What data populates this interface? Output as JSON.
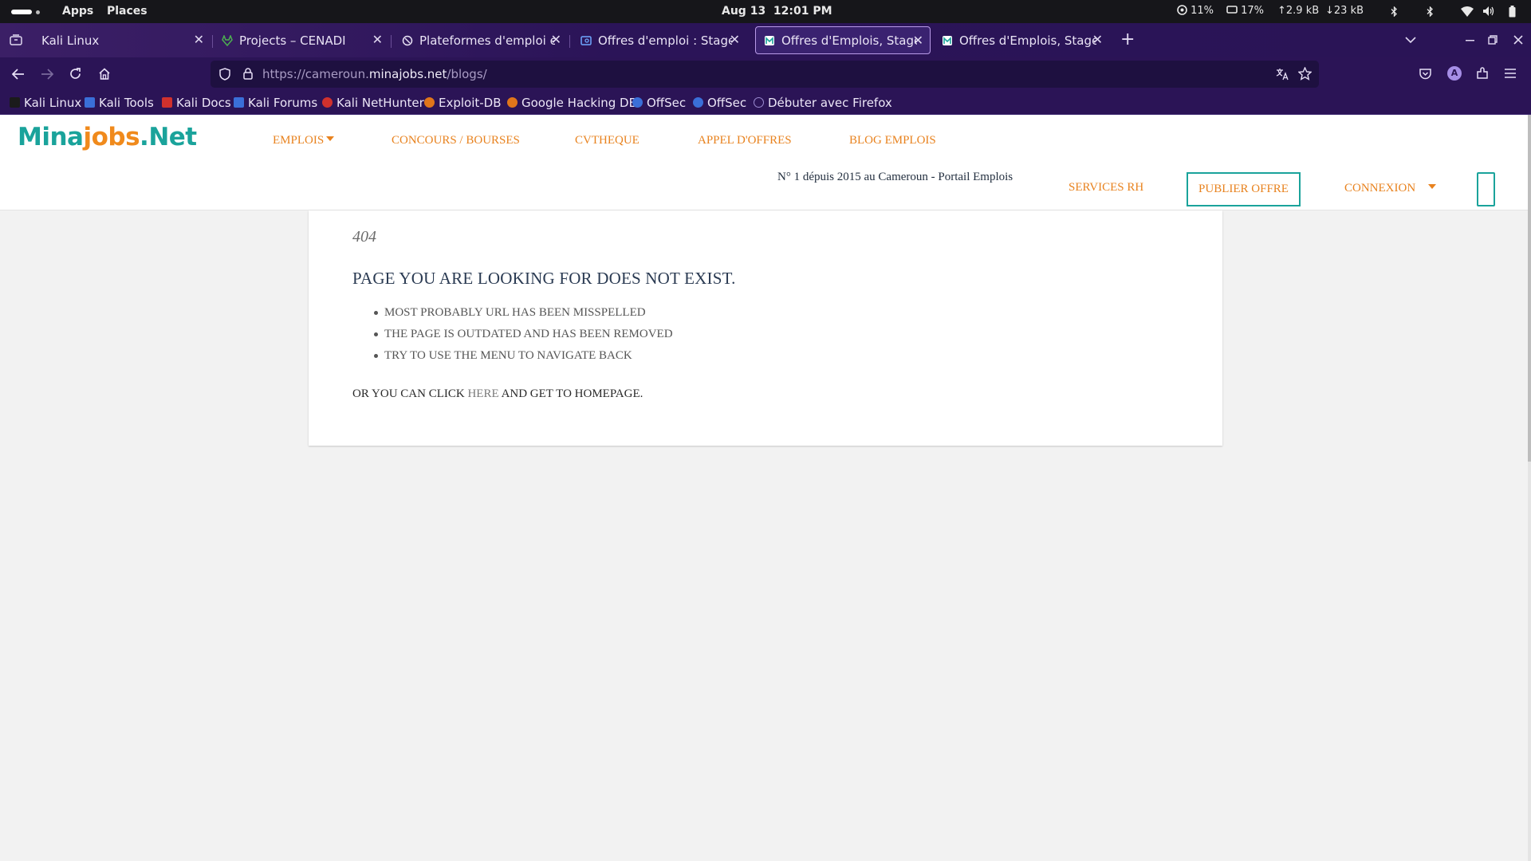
{
  "system_bar": {
    "apps": "Apps",
    "places": "Places",
    "clock": "Aug 13  12:01 PM",
    "cpu": "11%",
    "mem": "17%",
    "upload": "2.9 kB",
    "download": "23 kB"
  },
  "tabs": [
    {
      "label": "Kali Linux",
      "active": false
    },
    {
      "label": "Projects – CENADI",
      "active": false
    },
    {
      "label": "Plateformes d'emploi et s",
      "active": false
    },
    {
      "label": "Offres d'emploi : Stage au",
      "active": false
    },
    {
      "label": "Offres d'Emplois, Stages",
      "active": true
    },
    {
      "label": "Offres d'Emplois, Stages",
      "active": false
    }
  ],
  "urlbar": {
    "prefix": "https://cameroun.",
    "domain": "minajobs.net",
    "path": "/blogs/"
  },
  "bookmarks": [
    {
      "label": "Kali Linux",
      "color": "#2d2d2d"
    },
    {
      "label": "Kali Tools",
      "color": "#3a6fd8"
    },
    {
      "label": "Kali Docs",
      "color": "#d0312d"
    },
    {
      "label": "Kali Forums",
      "color": "#3a6fd8"
    },
    {
      "label": "Kali NetHunter",
      "color": "#d0312d"
    },
    {
      "label": "Exploit-DB",
      "color": "#e0761a"
    },
    {
      "label": "Google Hacking DB",
      "color": "#e0761a"
    },
    {
      "label": "OffSec",
      "color": "#3a6fd8"
    },
    {
      "label": "OffSec",
      "color": "#3a6fd8"
    },
    {
      "label": "Débuter avec Firefox",
      "color": "#9a8ad0"
    }
  ],
  "site": {
    "logo_part1": "Mina",
    "logo_part2": "jobs",
    "logo_part3": ".Net",
    "menu": {
      "emplois": "EMPLOIS",
      "concours": "CONCOURS / BOURSES",
      "cvtheque": "CVTHEQUE",
      "appel": "APPEL D'OFFRES",
      "blog": "BLOG EMPLOIS",
      "services": "SERVICES RH",
      "publier": "PUBLIER OFFRE",
      "connexion": "CONNEXION"
    },
    "tagline": "N° 1 dépuis 2015 au Cameroun - Portail Emplois"
  },
  "error_page": {
    "code": "404",
    "title": "PAGE YOU ARE LOOKING FOR DOES NOT EXIST.",
    "reasons": [
      "MOST PROBABLY URL HAS BEEN MISSPELLED",
      "THE PAGE IS OUTDATED AND HAS BEEN REMOVED",
      "TRY TO USE THE MENU TO NAVIGATE BACK"
    ],
    "footer_before": "OR YOU CAN CLICK",
    "footer_link": "HERE",
    "footer_after": "AND GET TO HOMEPAGE."
  },
  "colors": {
    "brand_teal": "#1aa39b",
    "brand_orange": "#e8821e",
    "browser_purple": "#2b1456"
  }
}
